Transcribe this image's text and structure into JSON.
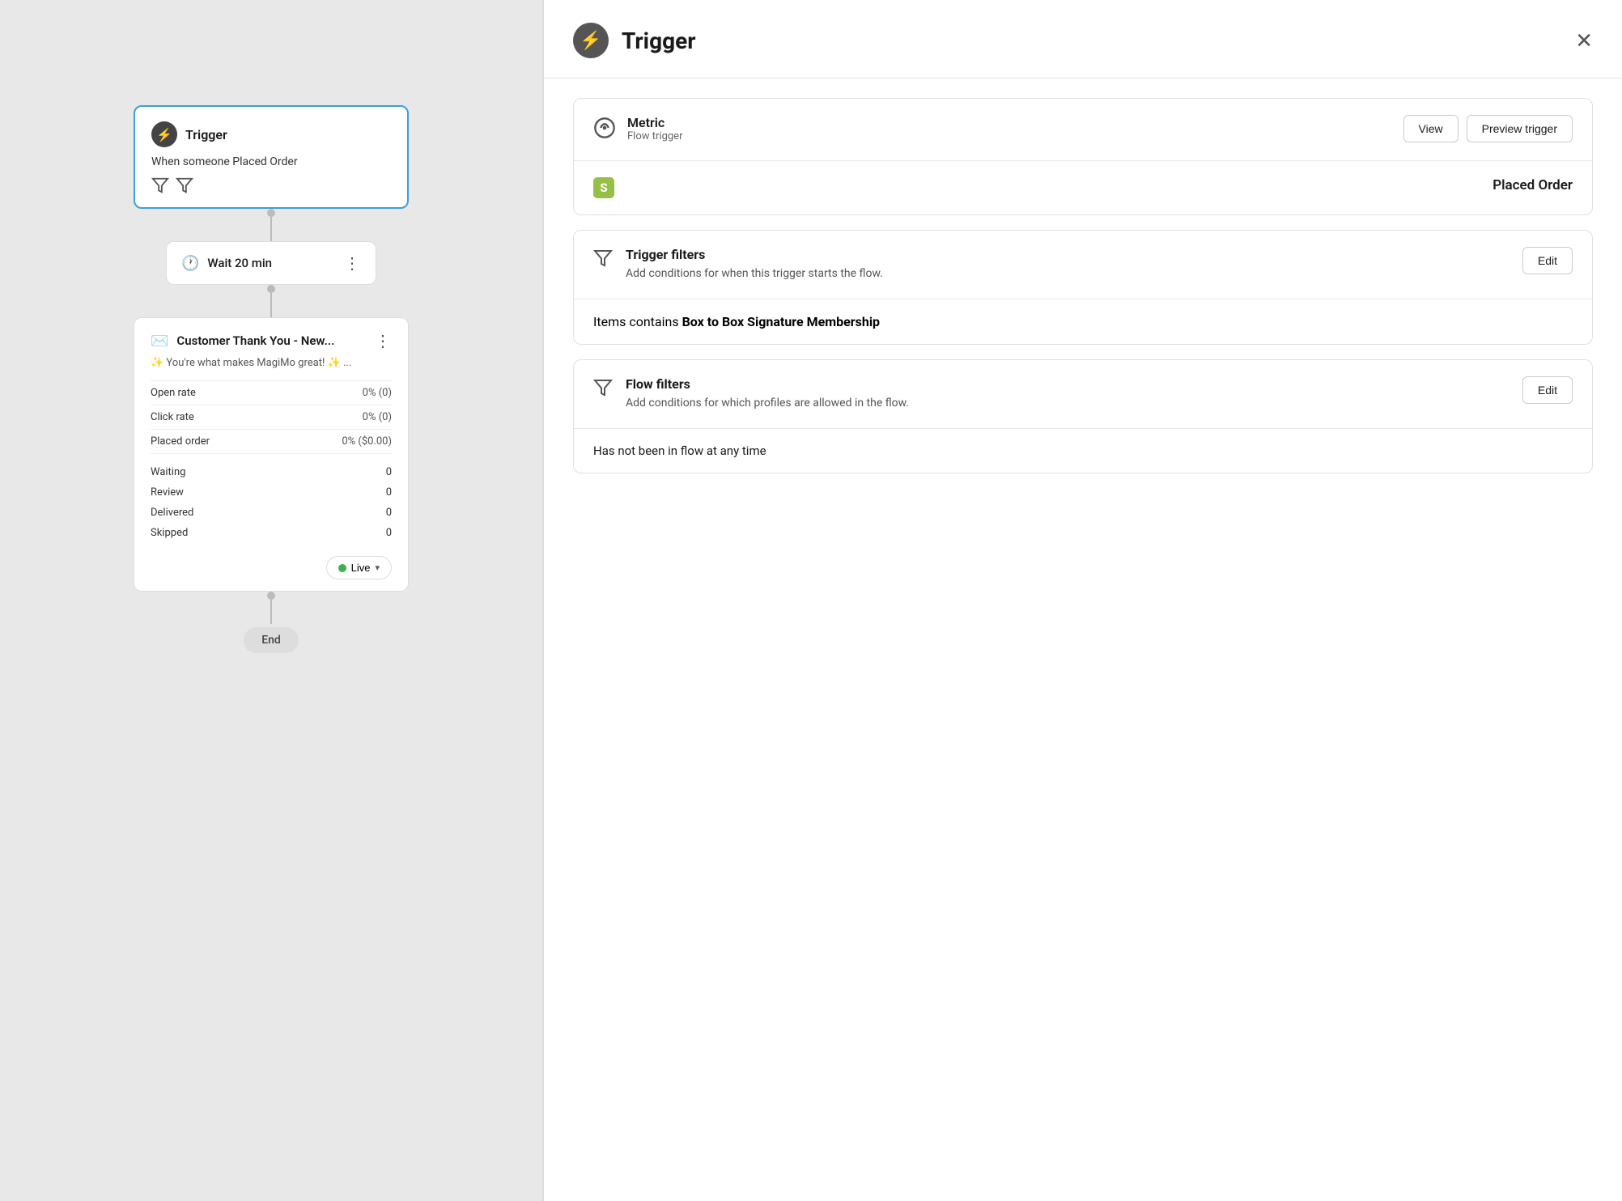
{
  "canvas": {
    "trigger_node": {
      "title": "Trigger",
      "subtitle": "When someone Placed Order"
    },
    "wait_node": {
      "label": "Wait 20 min"
    },
    "email_node": {
      "title": "Customer Thank You - New...",
      "preview": "✨ You're what makes MagiMo great! ✨ ...",
      "stats": [
        {
          "label": "Open rate",
          "value": "0%  (0)"
        },
        {
          "label": "Click rate",
          "value": "0%  (0)"
        },
        {
          "label": "Placed order",
          "value": "0%  ($0.00)"
        }
      ],
      "counts": [
        {
          "label": "Waiting",
          "value": "0"
        },
        {
          "label": "Review",
          "value": "0"
        },
        {
          "label": "Delivered",
          "value": "0"
        },
        {
          "label": "Skipped",
          "value": "0"
        }
      ],
      "live_label": "Live"
    },
    "end_node": {
      "label": "End"
    }
  },
  "panel": {
    "title": "Trigger",
    "close_label": "×",
    "metric_section": {
      "label": "Metric",
      "sub_label": "Flow trigger",
      "view_btn": "View",
      "preview_btn": "Preview trigger"
    },
    "placed_order": {
      "label": "Placed Order"
    },
    "trigger_filters": {
      "heading": "Trigger filters",
      "description": "Add conditions for when this trigger starts the flow.",
      "edit_btn": "Edit",
      "value_text": "Items",
      "value_contains": " contains ",
      "value_item": "Box to Box Signature Membership"
    },
    "flow_filters": {
      "heading": "Flow filters",
      "description": "Add conditions for which profiles are allowed in the flow.",
      "edit_btn": "Edit",
      "value_text": "Has not been in flow at any time"
    }
  }
}
